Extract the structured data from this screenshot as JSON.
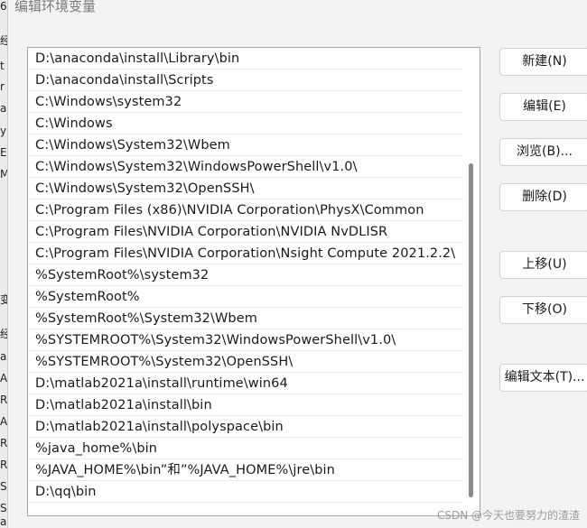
{
  "window": {
    "title": "编辑环境变量"
  },
  "paths": [
    "D:\\anaconda\\install\\Library\\bin",
    "D:\\anaconda\\install\\Scripts",
    "C:\\Windows\\system32",
    "C:\\Windows",
    "C:\\Windows\\System32\\Wbem",
    "C:\\Windows\\System32\\WindowsPowerShell\\v1.0\\",
    "C:\\Windows\\System32\\OpenSSH\\",
    "C:\\Program Files (x86)\\NVIDIA Corporation\\PhysX\\Common",
    "C:\\Program Files\\NVIDIA Corporation\\NVIDIA NvDLISR",
    "C:\\Program Files\\NVIDIA Corporation\\Nsight Compute 2021.2.2\\",
    "%SystemRoot%\\system32",
    "%SystemRoot%",
    "%SystemRoot%\\System32\\Wbem",
    "%SYSTEMROOT%\\System32\\WindowsPowerShell\\v1.0\\",
    "%SYSTEMROOT%\\System32\\OpenSSH\\",
    "D:\\matlab2021a\\install\\runtime\\win64",
    "D:\\matlab2021a\\install\\bin",
    "D:\\matlab2021a\\install\\polyspace\\bin",
    "%java_home%\\bin",
    "%JAVA_HOME%\\bin”和”%JAVA_HOME%\\jre\\bin",
    "D:\\qq\\bin"
  ],
  "buttons": {
    "new": "新建(N)",
    "edit": "编辑(E)",
    "browse": "浏览(B)...",
    "delete": "删除(D)",
    "move_up": "上移(U)",
    "move_down": "下移(O)",
    "edit_text": "编辑文本(T)..."
  },
  "left_strip_fragments": [
    "6",
    "经",
    "t",
    "r",
    "a",
    "y",
    "E",
    "M",
    "变",
    "经",
    "a",
    "A",
    "R",
    "A",
    "R",
    "R",
    "S",
    "S",
    "a"
  ],
  "watermark": "CSDN @今天也要努力的渣渣"
}
